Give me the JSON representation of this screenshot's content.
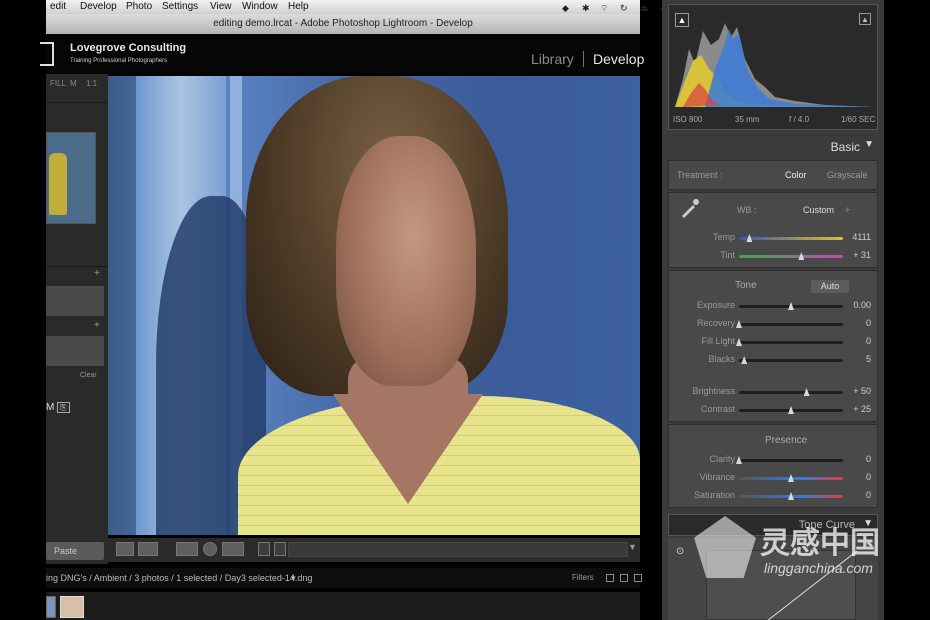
{
  "menubar": {
    "items": [
      "edit",
      "Develop",
      "Photo",
      "Settings",
      "View",
      "Window",
      "Help"
    ]
  },
  "titlebar": {
    "title": "editing demo.lrcat - Adobe Photoshop Lightroom - Develop",
    "collapse_arrow": "▲"
  },
  "identity_plate": {
    "name": "Lovegrove Consulting",
    "tagline": "Training Professional Photographers"
  },
  "modules": {
    "library": "Library",
    "develop": "Develop"
  },
  "left_panel": {
    "nav_labels": [
      "FILL",
      "1:1"
    ],
    "nav_zoom": "M",
    "plus": "+",
    "small_label": "Clear",
    "paste_button": "Paste"
  },
  "filmstrip": {
    "path": "ing DNG's / Ambient / 3 photos / 1 selected / Day3 selected-14.dng",
    "filters": "Filters"
  },
  "histogram": {
    "iso": "ISO 800",
    "focal": "35 mm",
    "aperture": "f / 4.0",
    "shutter": "1/60 SEC"
  },
  "basic": {
    "title": "Basic",
    "treatment_label": "Treatment :",
    "color": "Color",
    "grayscale": "Grayscale",
    "wb_label": "WB :",
    "wb_value": "Custom",
    "tone_label": "Tone",
    "auto": "Auto",
    "presence_label": "Presence",
    "sliders": [
      {
        "label": "Temp",
        "value": "4111",
        "position": 0.1
      },
      {
        "label": "Tint",
        "value": "+ 31",
        "position": 0.6
      },
      {
        "label": "Exposure",
        "value": "0.00",
        "position": 0.5
      },
      {
        "label": "Recovery",
        "value": "0",
        "position": 0.0
      },
      {
        "label": "Fill Light",
        "value": "0",
        "position": 0.0
      },
      {
        "label": "Blacks",
        "value": "5",
        "position": 0.05
      },
      {
        "label": "Brightness",
        "value": "+ 50",
        "position": 0.65
      },
      {
        "label": "Contrast",
        "value": "+ 25",
        "position": 0.5
      },
      {
        "label": "Clarity",
        "value": "0",
        "position": 0.0
      },
      {
        "label": "Vibrance",
        "value": "0",
        "position": 0.5
      },
      {
        "label": "Saturation",
        "value": "0",
        "position": 0.5
      }
    ]
  },
  "tone_curve": {
    "title": "Tone Curve"
  },
  "watermark": {
    "brand": "灵感中国",
    "url": "lingganchina.com"
  }
}
